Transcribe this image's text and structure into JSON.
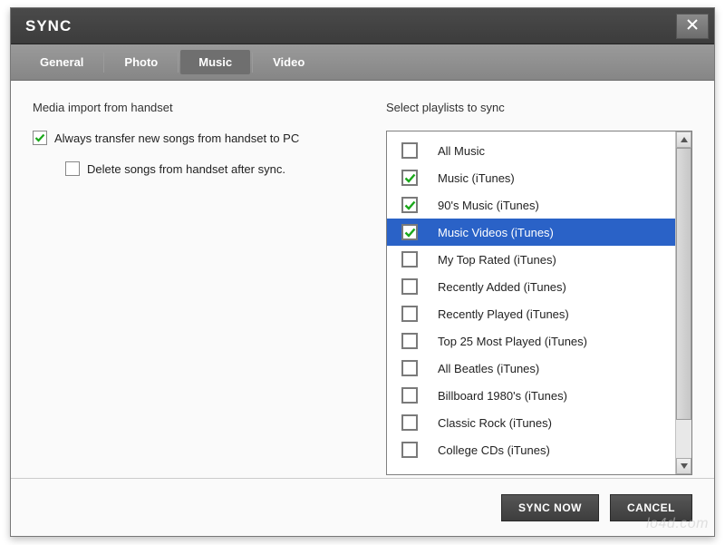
{
  "titlebar": {
    "title": "SYNC"
  },
  "tabs": [
    {
      "label": "General",
      "active": false
    },
    {
      "label": "Photo",
      "active": false
    },
    {
      "label": "Music",
      "active": true
    },
    {
      "label": "Video",
      "active": false
    }
  ],
  "left": {
    "section_title": "Media import from handset",
    "transfer": {
      "label": "Always transfer new songs from handset to PC",
      "checked": true
    },
    "delete": {
      "label": "Delete songs from handset after sync.",
      "checked": false
    }
  },
  "right": {
    "section_title": "Select playlists to sync",
    "playlists": [
      {
        "label": "All Music",
        "checked": false,
        "selected": false
      },
      {
        "label": "Music (iTunes)",
        "checked": true,
        "selected": false
      },
      {
        "label": "90's Music (iTunes)",
        "checked": true,
        "selected": false
      },
      {
        "label": "Music Videos (iTunes)",
        "checked": true,
        "selected": true
      },
      {
        "label": "My Top Rated (iTunes)",
        "checked": false,
        "selected": false
      },
      {
        "label": "Recently Added (iTunes)",
        "checked": false,
        "selected": false
      },
      {
        "label": "Recently Played (iTunes)",
        "checked": false,
        "selected": false
      },
      {
        "label": "Top 25 Most Played (iTunes)",
        "checked": false,
        "selected": false
      },
      {
        "label": "All Beatles (iTunes)",
        "checked": false,
        "selected": false
      },
      {
        "label": "Billboard 1980's (iTunes)",
        "checked": false,
        "selected": false
      },
      {
        "label": "Classic Rock (iTunes)",
        "checked": false,
        "selected": false
      },
      {
        "label": "College CDs (iTunes)",
        "checked": false,
        "selected": false
      }
    ]
  },
  "footer": {
    "sync_label": "SYNC NOW",
    "cancel_label": "CANCEL"
  },
  "colors": {
    "check_green": "#1aa81a",
    "selection_blue": "#2a62c7"
  },
  "watermark": "lo4d.com"
}
